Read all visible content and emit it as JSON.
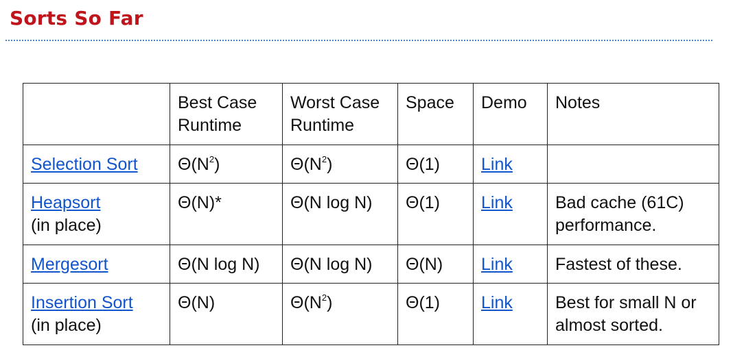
{
  "title": "Sorts So Far",
  "table": {
    "headers": {
      "best_case": "Best Case Runtime",
      "worst_case": "Worst Case Runtime",
      "space": "Space",
      "demo": "Demo",
      "notes": "Notes"
    },
    "rows": [
      {
        "name": "Selection Sort",
        "subtitle": "",
        "best": "Θ(N",
        "best_sup": "2",
        "best_tail": ")",
        "worst": "Θ(N",
        "worst_sup": "2",
        "worst_tail": ")",
        "space": "Θ(1)",
        "demo": "Link",
        "notes": ""
      },
      {
        "name": "Heapsort",
        "subtitle": "(in place)",
        "best": "Θ(N)*",
        "best_sup": "",
        "best_tail": "",
        "worst": "Θ(N log N)",
        "worst_sup": "",
        "worst_tail": "",
        "space": "Θ(1)",
        "demo": "Link",
        "notes": "Bad cache (61C) performance."
      },
      {
        "name": "Mergesort",
        "subtitle": "",
        "best": "Θ(N log N)",
        "best_sup": "",
        "best_tail": "",
        "worst": "Θ(N log N)",
        "worst_sup": "",
        "worst_tail": "",
        "space": "Θ(N)",
        "demo": "Link",
        "notes": "Fastest of these."
      },
      {
        "name": "Insertion Sort",
        "subtitle": "(in place)",
        "best": "Θ(N)",
        "best_sup": "",
        "best_tail": "",
        "worst": "Θ(N",
        "worst_sup": "2",
        "worst_tail": ")",
        "space": "Θ(1)",
        "demo": "Link",
        "notes": "Best for small N or almost sorted."
      }
    ]
  },
  "colors": {
    "title": "#c0141c",
    "rule": "#4a86c8",
    "link": "#1155cc",
    "text": "#111111",
    "border": "#222222"
  }
}
